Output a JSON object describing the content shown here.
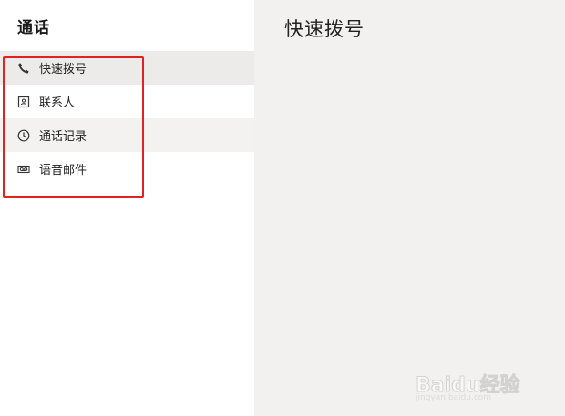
{
  "sidebar": {
    "title": "通话",
    "items": [
      {
        "label": "快速拨号",
        "icon": "phone-icon",
        "selected": true
      },
      {
        "label": "联系人",
        "icon": "contact-card-icon",
        "selected": false
      },
      {
        "label": "通话记录",
        "icon": "clock-icon",
        "selected": false
      },
      {
        "label": "语音邮件",
        "icon": "voicemail-icon",
        "selected": false
      }
    ]
  },
  "main": {
    "title": "快速拨号"
  },
  "annotation": {
    "color": "#e02222"
  },
  "watermark": {
    "brand": "Baidu经验",
    "url": "jingyan.baidu.com"
  }
}
